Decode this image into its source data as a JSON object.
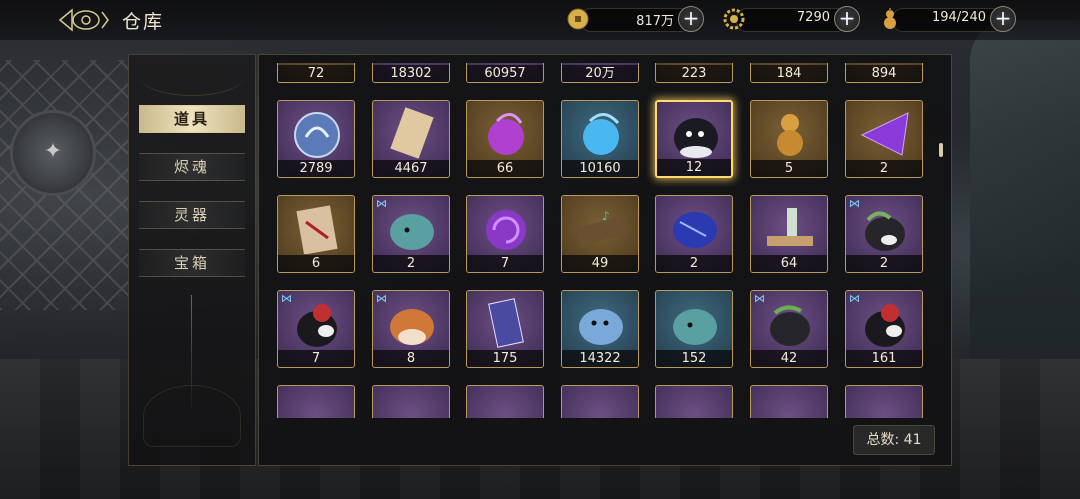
{
  "header": {
    "title": "仓库",
    "resources": [
      {
        "icon": "coin-icon",
        "value": "817万"
      },
      {
        "icon": "gear-token-icon",
        "value": "7290"
      },
      {
        "icon": "gourd-icon",
        "value": "194/240"
      }
    ],
    "plus_label": "+"
  },
  "tabs": [
    {
      "label": "道具",
      "active": true
    },
    {
      "label": "烬魂",
      "active": false
    },
    {
      "label": "灵器",
      "active": false
    },
    {
      "label": "宝箱",
      "active": false
    }
  ],
  "inventory": {
    "rows": [
      [
        {
          "icon": "feather-scroll-icon",
          "count": "72",
          "bg": "gold"
        },
        {
          "icon": "silver-shell-icon",
          "count": "18302",
          "bg": "purple"
        },
        {
          "icon": "flower-cluster-icon",
          "count": "60957",
          "bg": "purple"
        },
        {
          "icon": "blue-flower-icon",
          "count": "20万",
          "bg": "purple"
        },
        {
          "icon": "jade-cluster-icon",
          "count": "223",
          "bg": "gold"
        },
        {
          "icon": "golden-feather-icon",
          "count": "184",
          "bg": "gold"
        },
        {
          "icon": "bun-icon",
          "count": "894",
          "bg": "gold"
        }
      ],
      [
        {
          "icon": "spirit-fox-medal-icon",
          "count": "2789",
          "bg": "purple"
        },
        {
          "icon": "paper-scroll-icon",
          "count": "4467",
          "bg": "purple"
        },
        {
          "icon": "purple-flame-orb-icon",
          "count": "66",
          "bg": "gold"
        },
        {
          "icon": "blue-flame-orb-icon",
          "count": "10160",
          "bg": "blue"
        },
        {
          "icon": "black-spirit-icon",
          "count": "12",
          "bg": "purple",
          "selected": true
        },
        {
          "icon": "golden-gourd-icon",
          "count": "5",
          "bg": "gold"
        },
        {
          "icon": "purple-crystal-icon",
          "count": "2",
          "bg": "gold"
        }
      ],
      [
        {
          "icon": "red-talisman-icon",
          "count": "6",
          "bg": "gold"
        },
        {
          "icon": "teal-spirit-icon",
          "count": "2",
          "bg": "purple",
          "butterfly": true
        },
        {
          "icon": "purple-vortex-icon",
          "count": "7",
          "bg": "purple"
        },
        {
          "icon": "music-qin-icon",
          "count": "49",
          "bg": "gold"
        },
        {
          "icon": "blue-crystal-ore-icon",
          "count": "2",
          "bg": "purple"
        },
        {
          "icon": "sake-tray-icon",
          "count": "64",
          "bg": "purple"
        },
        {
          "icon": "leaf-spirit-icon",
          "count": "2",
          "bg": "purple",
          "butterfly": true
        }
      ],
      [
        {
          "icon": "red-masked-spirit-icon",
          "count": "7",
          "bg": "purple",
          "butterfly": true
        },
        {
          "icon": "orange-spirit-icon",
          "count": "8",
          "bg": "purple",
          "butterfly": true
        },
        {
          "icon": "purple-card-icon",
          "count": "175",
          "bg": "purple"
        },
        {
          "icon": "blue-horned-spirit-icon",
          "count": "14322",
          "bg": "blue"
        },
        {
          "icon": "teal-spirit-icon",
          "count": "152",
          "bg": "blue"
        },
        {
          "icon": "dark-leaf-spirit-icon",
          "count": "42",
          "bg": "purple",
          "butterfly": true
        },
        {
          "icon": "red-masked-spirit-icon",
          "count": "161",
          "bg": "purple",
          "butterfly": true
        }
      ]
    ]
  },
  "footer": {
    "total_label": "总数: 41"
  },
  "colors": {
    "accent_gold": "#b89a5c",
    "selected_glow": "#ffd96a",
    "tab_active": "#efe3bf"
  }
}
